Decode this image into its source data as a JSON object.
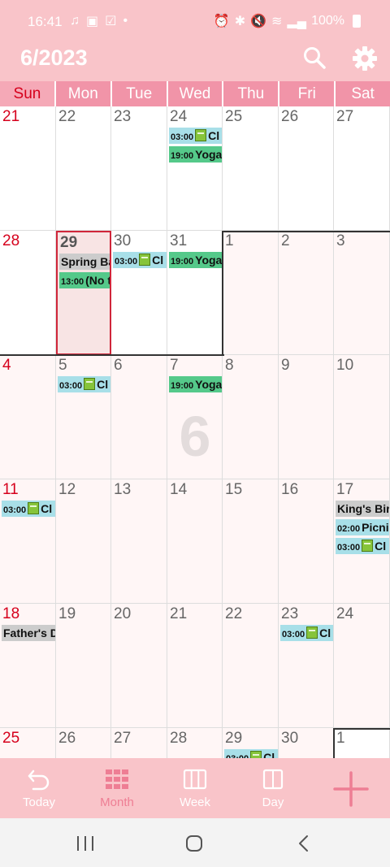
{
  "status": {
    "time": "16:41",
    "battery": "100%"
  },
  "header": {
    "title": "6/2023"
  },
  "weekdays": [
    "Sun",
    "Mon",
    "Tue",
    "Wed",
    "Thu",
    "Fri",
    "Sat"
  ],
  "big_month": "6",
  "weeks": [
    {
      "days": [
        {
          "n": "21",
          "cur": false
        },
        {
          "n": "22",
          "cur": false
        },
        {
          "n": "23",
          "cur": false
        },
        {
          "n": "24",
          "cur": false,
          "events": [
            {
              "time": "03:00",
              "text": "Cl",
              "color": "blue",
              "icon": "book"
            },
            {
              "time": "19:00",
              "text": "Yoga",
              "color": "green"
            }
          ]
        },
        {
          "n": "25",
          "cur": false
        },
        {
          "n": "26",
          "cur": false
        },
        {
          "n": "27",
          "cur": false
        }
      ]
    },
    {
      "days": [
        {
          "n": "28",
          "cur": false
        },
        {
          "n": "29",
          "cur": false,
          "today": true,
          "events": [
            {
              "text": "Spring Ba",
              "color": "gray"
            },
            {
              "time": "13:00",
              "text": "(No t",
              "color": "green"
            }
          ]
        },
        {
          "n": "30",
          "cur": false,
          "events": [
            {
              "time": "03:00",
              "text": "Cl",
              "color": "blue",
              "icon": "book"
            }
          ]
        },
        {
          "n": "31",
          "cur": false,
          "events": [
            {
              "time": "19:00",
              "text": "Yoga",
              "color": "green"
            }
          ]
        },
        {
          "n": "1",
          "cur": true
        },
        {
          "n": "2",
          "cur": true
        },
        {
          "n": "3",
          "cur": true
        }
      ]
    },
    {
      "days": [
        {
          "n": "4",
          "cur": true
        },
        {
          "n": "5",
          "cur": true,
          "events": [
            {
              "time": "03:00",
              "text": "Cl",
              "color": "blue",
              "icon": "book"
            }
          ]
        },
        {
          "n": "6",
          "cur": true
        },
        {
          "n": "7",
          "cur": true,
          "events": [
            {
              "time": "19:00",
              "text": "Yoga",
              "color": "green"
            }
          ]
        },
        {
          "n": "8",
          "cur": true
        },
        {
          "n": "9",
          "cur": true
        },
        {
          "n": "10",
          "cur": true
        }
      ]
    },
    {
      "days": [
        {
          "n": "11",
          "cur": true,
          "events": [
            {
              "time": "03:00",
              "text": "Cl",
              "color": "blue",
              "icon": "book"
            }
          ]
        },
        {
          "n": "12",
          "cur": true
        },
        {
          "n": "13",
          "cur": true
        },
        {
          "n": "14",
          "cur": true
        },
        {
          "n": "15",
          "cur": true
        },
        {
          "n": "16",
          "cur": true
        },
        {
          "n": "17",
          "cur": true,
          "events": [
            {
              "text": "King's Bir",
              "color": "gray"
            },
            {
              "time": "02:00",
              "text": "Picni",
              "color": "blue"
            },
            {
              "time": "03:00",
              "text": "Cl",
              "color": "blue",
              "icon": "book"
            }
          ]
        }
      ]
    },
    {
      "days": [
        {
          "n": "18",
          "cur": true,
          "events": [
            {
              "text": "Father's D",
              "color": "gray"
            }
          ]
        },
        {
          "n": "19",
          "cur": true
        },
        {
          "n": "20",
          "cur": true
        },
        {
          "n": "21",
          "cur": true
        },
        {
          "n": "22",
          "cur": true
        },
        {
          "n": "23",
          "cur": true,
          "events": [
            {
              "time": "03:00",
              "text": "Cl",
              "color": "blue",
              "icon": "book"
            }
          ]
        },
        {
          "n": "24",
          "cur": true
        }
      ]
    },
    {
      "days": [
        {
          "n": "25",
          "cur": true
        },
        {
          "n": "26",
          "cur": true
        },
        {
          "n": "27",
          "cur": true
        },
        {
          "n": "28",
          "cur": true
        },
        {
          "n": "29",
          "cur": true,
          "events": [
            {
              "time": "03:00",
              "text": "Cl",
              "color": "blue",
              "icon": "book"
            }
          ]
        },
        {
          "n": "30",
          "cur": true
        },
        {
          "n": "1",
          "cur": false
        }
      ]
    }
  ],
  "nav": {
    "today": "Today",
    "month": "Month",
    "week": "Week",
    "day": "Day"
  },
  "colors": {
    "header_bg": "#f9c4c9",
    "weekday_bg": "#f194a8",
    "sunday_red": "#d6001c",
    "accent": "#ee7e94",
    "event_blue": "#a8dfe8",
    "event_green": "#55c98a",
    "event_gray": "#cccccc"
  }
}
